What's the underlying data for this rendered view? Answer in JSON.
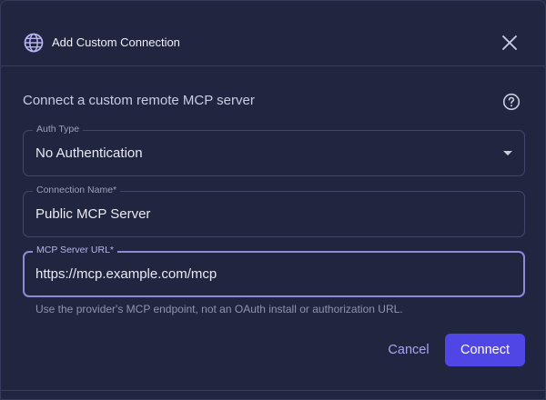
{
  "dialog": {
    "title": "Add Custom Connection",
    "title_icon": "globe-icon",
    "close_icon": "close-icon"
  },
  "intro": {
    "text": "Connect a custom remote MCP server",
    "help_icon": "help-circle-icon"
  },
  "fields": {
    "auth_type": {
      "label": "Auth Type",
      "value": "No Authentication"
    },
    "connection_name": {
      "label": "Connection Name",
      "required_mark": "*",
      "value": "Public MCP Server"
    },
    "server_url": {
      "label": "MCP Server URL",
      "required_mark": "*",
      "value": "https://mcp.example.com/mcp",
      "hint": "Use the provider's MCP endpoint, not an OAuth install or authorization URL."
    }
  },
  "actions": {
    "cancel_label": "Cancel",
    "connect_label": "Connect"
  },
  "colors": {
    "background": "#212640",
    "accent": "#4f46e5",
    "focus_border": "#8f8ad8"
  }
}
